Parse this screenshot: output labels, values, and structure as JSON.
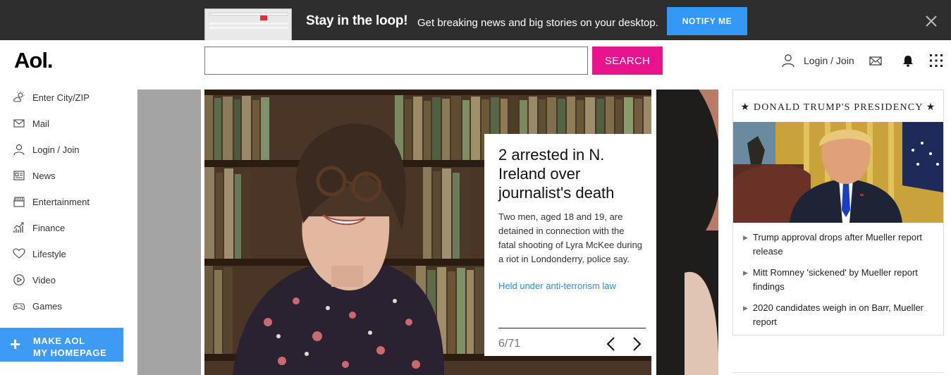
{
  "banner": {
    "title": "Stay in the loop!",
    "text": "Get breaking news and big stories on your desktop.",
    "notify_label": "NOTIFY ME"
  },
  "header": {
    "logo": "Aol.",
    "search_value": "",
    "search_label": "SEARCH",
    "login_label": "Login / Join"
  },
  "sidebar": {
    "items": [
      {
        "label": "Enter City/ZIP",
        "icon": "weather-icon"
      },
      {
        "label": "Mail",
        "icon": "mail-icon"
      },
      {
        "label": "Login / Join",
        "icon": "user-icon"
      },
      {
        "label": "News",
        "icon": "news-icon"
      },
      {
        "label": "Entertainment",
        "icon": "clapper-icon"
      },
      {
        "label": "Finance",
        "icon": "finance-icon"
      },
      {
        "label": "Lifestyle",
        "icon": "heart-icon"
      },
      {
        "label": "Video",
        "icon": "play-icon"
      },
      {
        "label": "Games",
        "icon": "gamepad-icon"
      }
    ],
    "make_home_line1": "MAKE AOL",
    "make_home_line2": "MY HOMEPAGE"
  },
  "carousel": {
    "title": "2 arrested in N. Ireland over journalist's death",
    "body": "Two men, aged 18 and 19, are detained in connection with the fatal shooting of Lyra McKee during a riot in Londonderry, police say.",
    "link": "Held under anti-terrorism law",
    "counter": "6/71"
  },
  "panel": {
    "title": "★ DONALD TRUMP'S PRESIDENCY ★",
    "stories": [
      "Trump approval drops after Mueller report release",
      "Mitt Romney 'sickened' by Mueller report findings",
      "2020 candidates weigh in on Barr, Mueller report"
    ]
  },
  "colors": {
    "banner_bg": "#2e2e2e",
    "notify": "#3397f5",
    "search": "#e8128c",
    "link": "#2a8fe8",
    "make_home": "#3d9bf5"
  }
}
